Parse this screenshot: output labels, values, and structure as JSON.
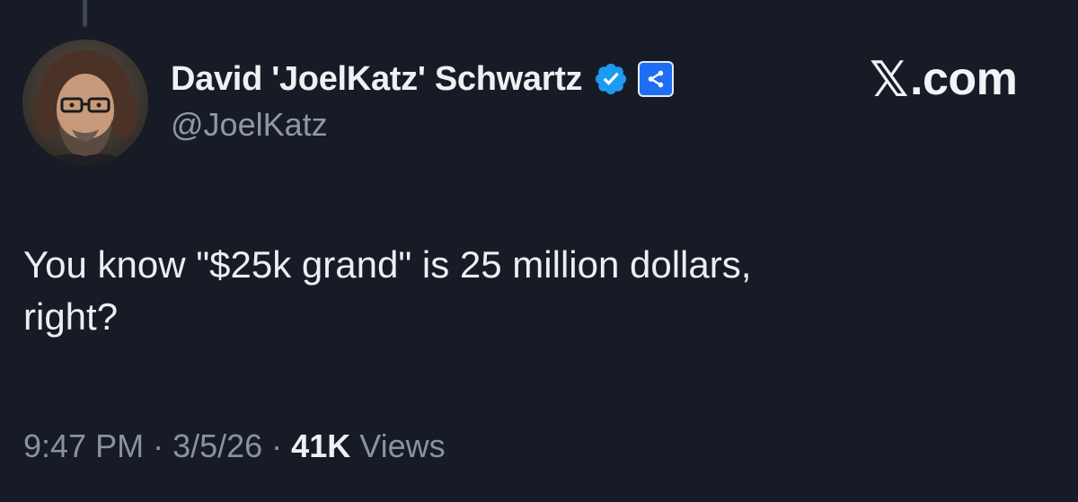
{
  "author": {
    "display_name": "David 'JoelKatz' Schwartz",
    "handle": "@JoelKatz",
    "verified_icon": "verified-checkmark-icon",
    "affiliate_icon": "ripple-affiliate-icon"
  },
  "watermark": {
    "logo": "𝕏",
    "domain": ".com"
  },
  "tweet": {
    "text": "You know \"$25k grand\" is 25 million dollars,\nright?"
  },
  "meta": {
    "time": "9:47 PM",
    "separator": "·",
    "date": "3/5/26",
    "views_count": "41K",
    "views_label": "Views"
  },
  "colors": {
    "background": "#161b26",
    "verified_blue": "#1d9bf0",
    "affiliate_blue": "#1d6ef2",
    "secondary_text": "#8a939d"
  }
}
